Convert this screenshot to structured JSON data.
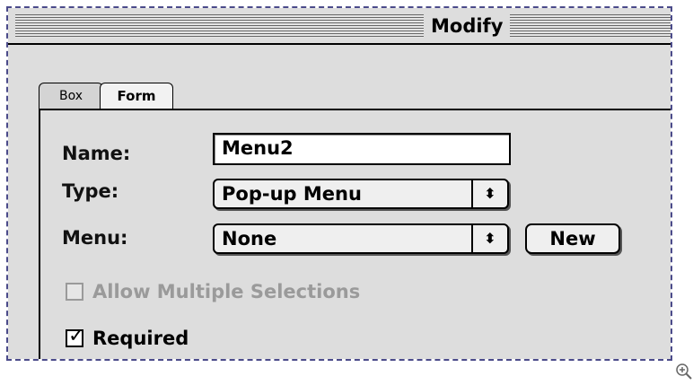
{
  "window": {
    "title": "Modify"
  },
  "tabs": [
    {
      "label": "Box",
      "active": false
    },
    {
      "label": "Form",
      "active": true
    }
  ],
  "form": {
    "name_label": "Name:",
    "name_value": "Menu2",
    "type_label": "Type:",
    "type_value": "Pop-up Menu",
    "menu_label": "Menu:",
    "menu_value": "None",
    "new_button": "New",
    "allow_multiple_label": "Allow Multiple Selections",
    "allow_multiple_checked": false,
    "allow_multiple_enabled": false,
    "required_label": "Required",
    "required_checked": true
  },
  "icons": {
    "popup_arrow": "up-down-arrows-icon",
    "check_mark": "check-mark-icon",
    "zoom": "zoom-in-icon"
  },
  "colors": {
    "window_bg": "#dddddd",
    "disabled_text": "#9a9a9a"
  }
}
